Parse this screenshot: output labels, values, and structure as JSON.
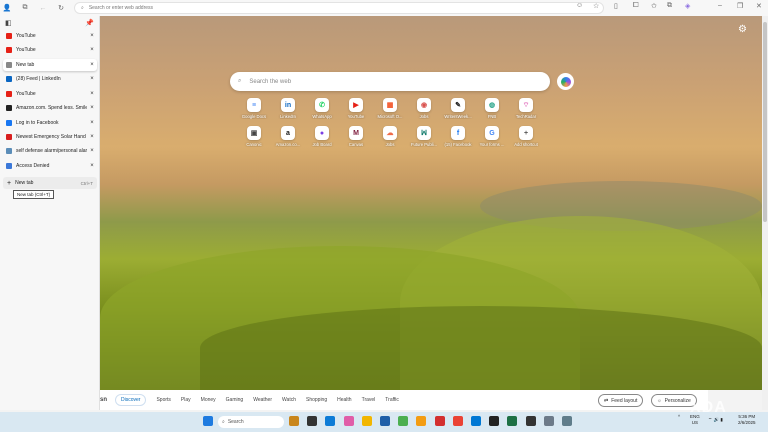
{
  "toolbar": {
    "address_placeholder": "Search or enter web address"
  },
  "vertical_tabs": {
    "tabs": [
      {
        "title": "YouTube",
        "icon": "youtube-icon",
        "color": "#e62117"
      },
      {
        "title": "YouTube",
        "icon": "youtube-icon",
        "color": "#e62117"
      },
      {
        "title": "New tab",
        "icon": "newtab-icon",
        "color": "#888888",
        "active": true
      },
      {
        "title": "(28) Feed | LinkedIn",
        "icon": "linkedin-icon",
        "color": "#0a66c2"
      },
      {
        "title": "YouTube",
        "icon": "youtube-icon",
        "color": "#e62117"
      },
      {
        "title": "Amazon.com. Spend less. Smile more.",
        "icon": "amazon-icon",
        "color": "#222222"
      },
      {
        "title": "Log in to Facebook",
        "icon": "facebook-icon",
        "color": "#1877f2"
      },
      {
        "title": "Newest Emergency Solar Hand Crank",
        "icon": "store-icon",
        "color": "#d81e1e"
      },
      {
        "title": "self defense alarm/personal alarm",
        "icon": "loading-icon",
        "color": "#5b8db8"
      },
      {
        "title": "Access Denied",
        "icon": "page-icon",
        "color": "#3b78d8"
      }
    ],
    "new_tab_label": "New tab",
    "new_tab_shortcut": "Ctrl+T",
    "tooltip": "New tab (Ctrl+T)"
  },
  "newtab_page": {
    "search_placeholder": "Search the web",
    "shortcuts": [
      {
        "label": "Google Docs",
        "glyph": "≡",
        "color": "#4285f4"
      },
      {
        "label": "LinkedIn",
        "glyph": "in",
        "color": "#0a66c2"
      },
      {
        "label": "WhatsApp",
        "glyph": "✆",
        "color": "#25d366"
      },
      {
        "label": "YouTube",
        "glyph": "▶",
        "color": "#e62117"
      },
      {
        "label": "Microsoft O...",
        "glyph": "▦",
        "color": "#f25022"
      },
      {
        "label": "Jobs",
        "glyph": "◉",
        "color": "#d9534f"
      },
      {
        "label": "WritersWeek...",
        "glyph": "✎",
        "color": "#222222"
      },
      {
        "label": "FNB",
        "glyph": "◍",
        "color": "#2aa58b"
      },
      {
        "label": "TechRadar",
        "glyph": "⌔",
        "color": "#d63fa6"
      },
      {
        "label": "Canonic",
        "glyph": "▣",
        "color": "#444444"
      },
      {
        "label": "Amazon.co...",
        "glyph": "a",
        "color": "#111111"
      },
      {
        "label": "Job Board",
        "glyph": "●",
        "color": "#7b3fe4"
      },
      {
        "label": "Canvas",
        "glyph": "M",
        "color": "#7d1b3c"
      },
      {
        "label": "Jobs",
        "glyph": "☁",
        "color": "#ef6c4a"
      },
      {
        "label": "Future Publi...",
        "glyph": "ꟽ",
        "color": "#0f7a6a"
      },
      {
        "label": "(15) Facebook",
        "glyph": "f",
        "color": "#1877f2"
      },
      {
        "label": "Your forms ...",
        "glyph": "G",
        "color": "#4285f4"
      },
      {
        "label": "Add shortcut",
        "glyph": "+",
        "color": "#555555"
      }
    ]
  },
  "msn": {
    "logo": "sn",
    "tabs": [
      "Discover",
      "Sports",
      "Play",
      "Money",
      "Gaming",
      "Weather",
      "Watch",
      "Shopping",
      "Health",
      "Travel",
      "Traffic"
    ],
    "active": "Discover",
    "feed_layout": "Feed layout",
    "personalize": "Personalize"
  },
  "taskbar": {
    "search_label": "Search",
    "lang_top": "ENG",
    "lang_bottom": "US",
    "time": "5:36 PM",
    "date": "2/6/2025"
  },
  "watermark": "XDA"
}
